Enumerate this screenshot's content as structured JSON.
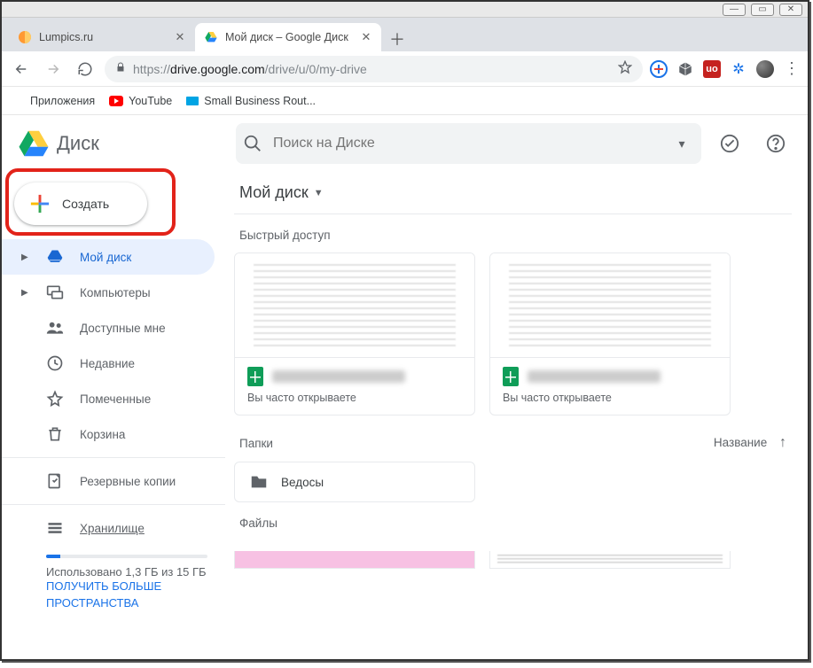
{
  "window": {
    "tabs": [
      {
        "title": "Lumpics.ru",
        "favicon": "orange"
      },
      {
        "title": "Мой диск – Google Диск",
        "favicon": "drive",
        "active": true
      }
    ]
  },
  "address": {
    "protocol": "https://",
    "host": "drive.google.com",
    "path": "/drive/u/0/my-drive"
  },
  "bookmarks": {
    "apps_label": "Приложения",
    "items": [
      {
        "label": "YouTube"
      },
      {
        "label": "Small Business Rout..."
      }
    ]
  },
  "drive": {
    "app_title": "Диск",
    "search_placeholder": "Поиск на Диске",
    "create_label": "Создать",
    "nav": {
      "my_drive": "Мой диск",
      "computers": "Компьютеры",
      "shared": "Доступные мне",
      "recent": "Недавние",
      "starred": "Помеченные",
      "trash": "Корзина",
      "backups": "Резервные копии",
      "storage": "Хранилище"
    },
    "storage_used": "Использовано 1,3 ГБ из 15 ГБ",
    "storage_cta": "ПОЛУЧИТЬ БОЛЬШЕ ПРОСТРАНСТВА",
    "breadcrumb": "Мой диск",
    "sections": {
      "quick_access": "Быстрый доступ",
      "folders": "Папки",
      "files": "Файлы",
      "sort_label": "Название"
    },
    "quick_access_cards": [
      {
        "subtitle": "Вы часто открываете"
      },
      {
        "subtitle": "Вы часто открываете"
      }
    ],
    "folders": [
      {
        "name": "Ведосы"
      }
    ]
  }
}
